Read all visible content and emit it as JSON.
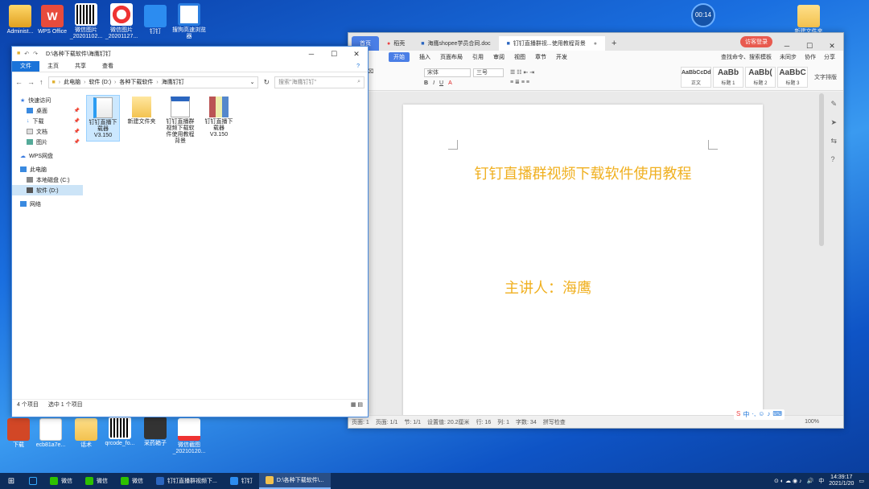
{
  "desktop": {
    "icons_top": [
      {
        "label": "Administ..."
      },
      {
        "label": "WPS Office"
      },
      {
        "label": "微信图片_20201102..."
      },
      {
        "label": "微信图片_20201127..."
      },
      {
        "label": "钉钉"
      },
      {
        "label": "搜狗高速浏览器"
      }
    ],
    "icon_right": {
      "label": "新建文件夹"
    },
    "icons_bottom": [
      {
        "label": "下载"
      },
      {
        "label": "ecb81a7e..."
      },
      {
        "label": "话术"
      },
      {
        "label": "qrcode_fo..."
      },
      {
        "label": "采药箱子"
      },
      {
        "label": "微信截图_20210120..."
      }
    ]
  },
  "timer": {
    "value": "00:14"
  },
  "explorer": {
    "title": "D:\\各种下载软件\\海鹰钉钉",
    "ribbon": {
      "file": "文件",
      "home": "主页",
      "share": "共享",
      "view": "查看"
    },
    "path": [
      "此电脑",
      "软件 (D:)",
      "各种下载软件",
      "海鹰钉钉"
    ],
    "search_placeholder": "搜索\"海鹰钉钉\"",
    "nav": [
      {
        "label": "快速访问",
        "level": 0
      },
      {
        "label": "桌面",
        "level": 1,
        "pin": true
      },
      {
        "label": "下载",
        "level": 1,
        "pin": true
      },
      {
        "label": "文档",
        "level": 1,
        "pin": true
      },
      {
        "label": "图片",
        "level": 1,
        "pin": true
      },
      {
        "label": "WPS网盘",
        "level": 0
      },
      {
        "label": "此电脑",
        "level": 0
      },
      {
        "label": "本地磁盘 (C:)",
        "level": 1
      },
      {
        "label": "软件 (D:)",
        "level": 1,
        "selected": true
      },
      {
        "label": "网络",
        "level": 0
      }
    ],
    "files": [
      {
        "name": "钉钉直播下载器 V3.150",
        "type": "exe",
        "selected": true
      },
      {
        "name": "新建文件夹",
        "type": "folder"
      },
      {
        "name": "钉钉直播群视频下载软件使用教程背景",
        "type": "word"
      },
      {
        "name": "钉钉直播下载器 V3.150",
        "type": "zip"
      }
    ],
    "status": {
      "count": "4 个项目",
      "selected": "选中 1 个项目"
    }
  },
  "wps": {
    "tabs": [
      {
        "label": "首页"
      },
      {
        "label": "稻壳"
      },
      {
        "label": "海鹰shopee学员合同.doc"
      },
      {
        "label": "钉钉直播群视...使用教程背景"
      }
    ],
    "login": "访客登录",
    "menu": [
      "开始",
      "插入",
      "页面布局",
      "引用",
      "审阅",
      "视图",
      "章节",
      "开发"
    ],
    "menu_right": [
      "查找命令、搜索模板",
      "未同步",
      "协作",
      "分享"
    ],
    "font": "宋体",
    "size": "三号",
    "styles": [
      {
        "preview": "AaBbCcDd",
        "name": "正文"
      },
      {
        "preview": "AaBb",
        "name": "标题 1"
      },
      {
        "preview": "AaBb(",
        "name": "标题 2"
      },
      {
        "preview": "AaBbC",
        "name": "标题 3"
      }
    ],
    "layout_label": "文字排版",
    "document": {
      "title": "钉钉直播群视频下载软件使用教程",
      "subtitle": "主讲人：海鹰"
    },
    "status": [
      "页面: 1",
      "页面: 1/1",
      "节: 1/1",
      "设置值: 20.2厘米",
      "行: 16",
      "列: 1",
      "字数: 34",
      "拼写检查"
    ],
    "zoom": "100%"
  },
  "taskbar": {
    "apps": [
      {
        "label": "微信"
      },
      {
        "label": "微信"
      },
      {
        "label": "微信"
      },
      {
        "label": "钉钉直播群视频下..."
      },
      {
        "label": "钉钉"
      },
      {
        "label": "D:\\各种下载软件\\..."
      }
    ],
    "time": "14:39:17",
    "date": "2021/1/20"
  }
}
